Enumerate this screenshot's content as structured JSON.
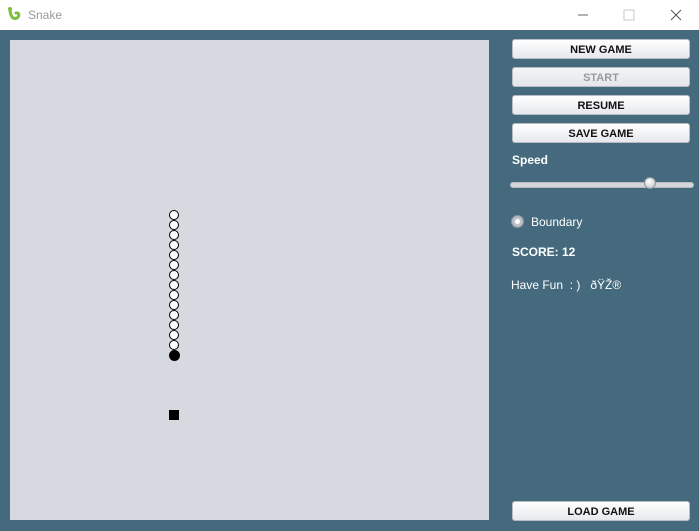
{
  "window": {
    "title": "Snake"
  },
  "controls": {
    "new_game": "NEW GAME",
    "start": "START",
    "resume": "RESUME",
    "save_game": "SAVE GAME",
    "load_game": "LOAD GAME",
    "speed_label": "Speed",
    "speed_level": 0.77,
    "boundary_label": "Boundary",
    "boundary_checked": false,
    "score_text": "SCORE: 12",
    "fun_text": "Have Fun  : )   ðŸŽ®"
  },
  "colors": {
    "background": "#456a7d",
    "board": "#d6d9e0",
    "snake": "#000000",
    "food": "#000000"
  },
  "icons": {
    "app": "snake-icon",
    "minimize": "minimize-icon",
    "maximize": "maximize-icon",
    "close": "close-icon"
  },
  "game": {
    "body_length": 14
  }
}
